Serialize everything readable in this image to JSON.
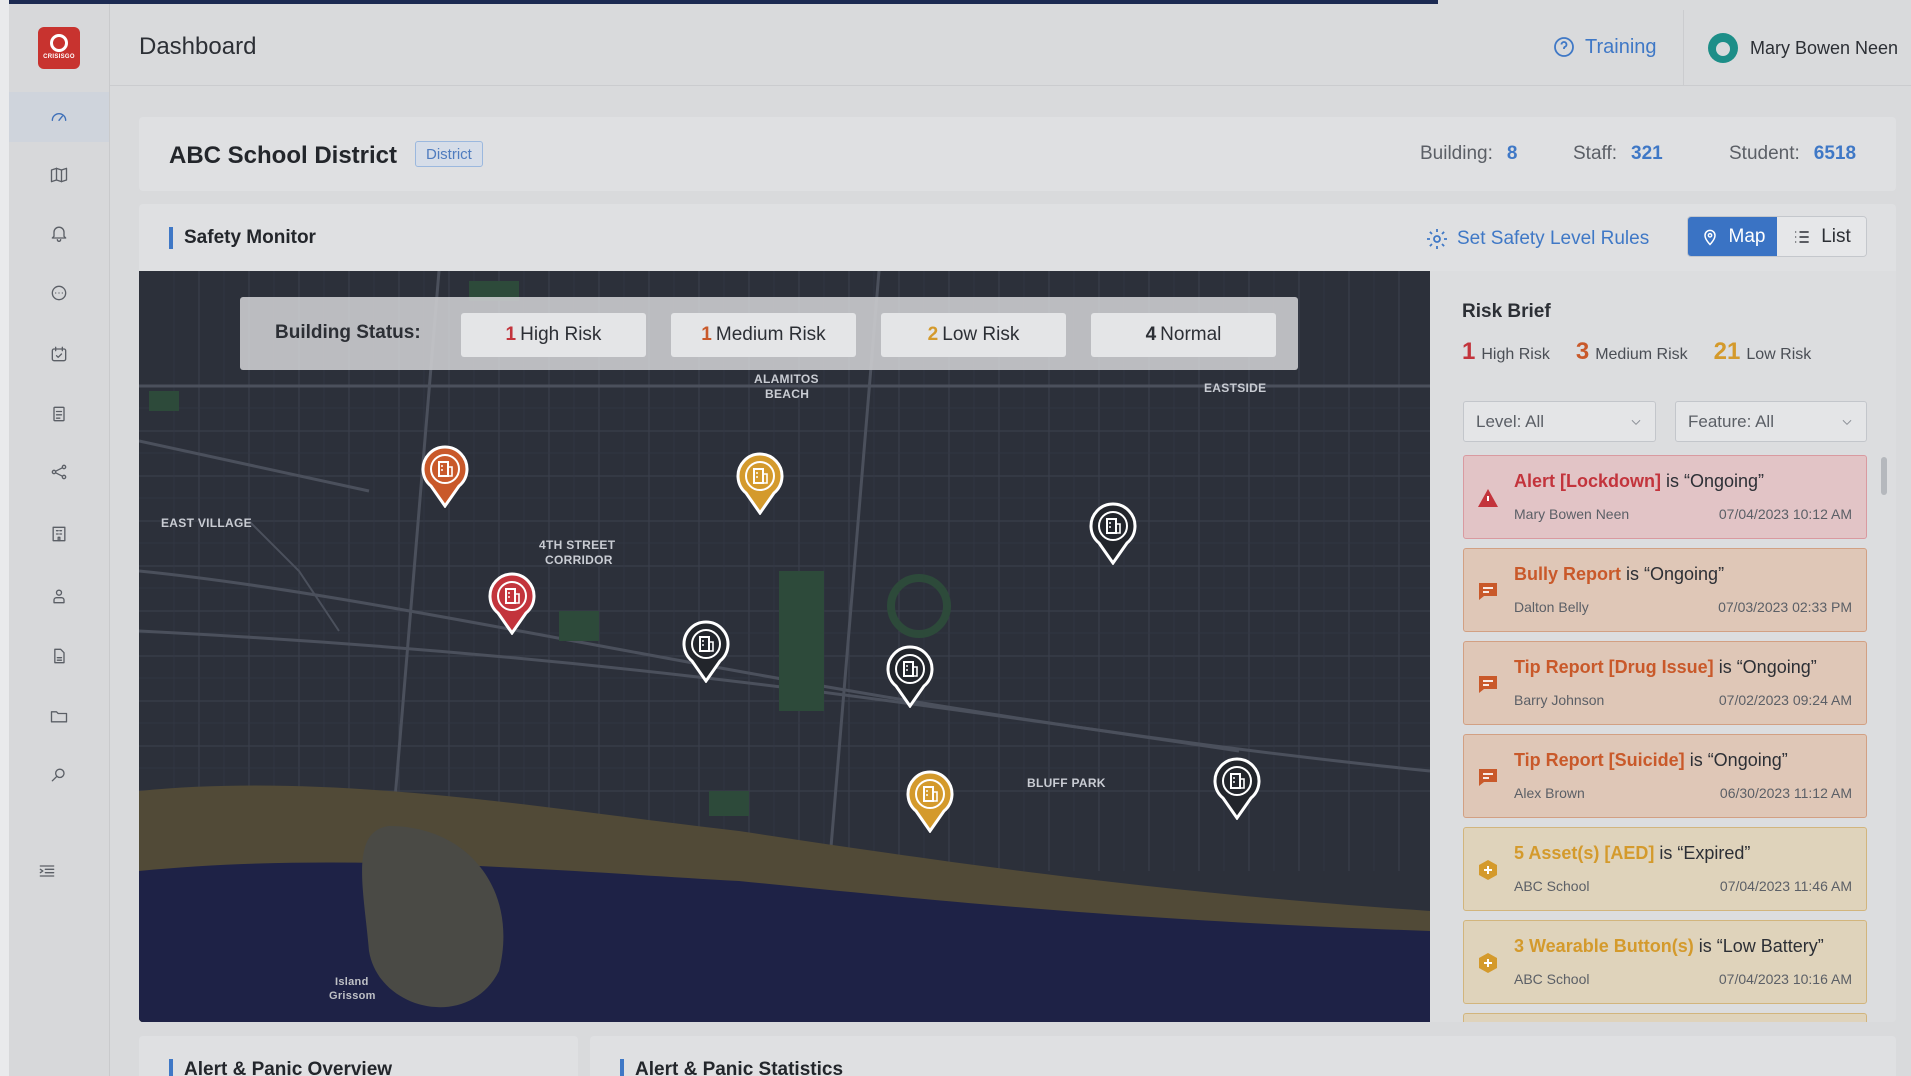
{
  "app": {
    "logo_text": "CRISISGO"
  },
  "header": {
    "title": "Dashboard",
    "training_label": "Training",
    "user_name": "Mary Bowen Neen"
  },
  "district": {
    "name": "ABC School District",
    "badge": "District",
    "stats": [
      {
        "label": "Building:",
        "value": "8"
      },
      {
        "label": "Staff:",
        "value": "321"
      },
      {
        "label": "Student:",
        "value": "6518"
      }
    ]
  },
  "safety_monitor": {
    "title": "Safety Monitor",
    "rules_link": "Set Safety Level Rules",
    "views": [
      {
        "label": "Map",
        "active": true
      },
      {
        "label": "List",
        "active": false
      }
    ],
    "building_status": {
      "label": "Building Status:",
      "items": [
        {
          "count": "1",
          "label": "High Risk",
          "color": "#c3343c"
        },
        {
          "count": "1",
          "label": "Medium Risk",
          "color": "#c9592a"
        },
        {
          "count": "2",
          "label": "Low Risk",
          "color": "#d49a2c"
        },
        {
          "count": "4",
          "label": "Normal",
          "color": "#2c2f35"
        }
      ]
    }
  },
  "map": {
    "labels": [
      "ALAMITOS",
      "BEACH",
      "EASTSIDE",
      "EAST VILLAGE",
      "4TH STREET",
      "CORRIDOR",
      "BLUFF PARK",
      "Island",
      "Grissom"
    ],
    "pins": [
      {
        "level": "medium",
        "color": "#c9592a"
      },
      {
        "level": "low",
        "color": "#d49a2c"
      },
      {
        "level": "normal",
        "color": "#22252b"
      },
      {
        "level": "high",
        "color": "#c3343c"
      },
      {
        "level": "normal",
        "color": "#22252b"
      },
      {
        "level": "normal",
        "color": "#22252b"
      },
      {
        "level": "low",
        "color": "#d49a2c"
      },
      {
        "level": "normal",
        "color": "#22252b"
      }
    ]
  },
  "risk_brief": {
    "title": "Risk Brief",
    "counts": [
      {
        "count": "1",
        "label": "High Risk",
        "color": "#c3343c"
      },
      {
        "count": "3",
        "label": "Medium Risk",
        "color": "#c9592a"
      },
      {
        "count": "21",
        "label": "Low Risk",
        "color": "#d49a2c"
      }
    ],
    "filters": {
      "level": "Level: All",
      "feature": "Feature: All"
    },
    "alerts": [
      {
        "kind": "Alert [Lockdown]",
        "status": " is “Ongoing”",
        "who": "Mary Bowen Neen",
        "when": "07/04/2023 10:12 AM",
        "tone": "red",
        "icon": "warning-icon"
      },
      {
        "kind": "Bully Report",
        "status": " is “Ongoing”",
        "who": "Dalton Belly",
        "when": "07/03/2023 02:33 PM",
        "tone": "orange",
        "icon": "report-icon"
      },
      {
        "kind": "Tip Report [Drug Issue]",
        "status": " is “Ongoing”",
        "who": "Barry Johnson",
        "when": "07/02/2023 09:24 AM",
        "tone": "orange",
        "icon": "report-icon"
      },
      {
        "kind": "Tip Report [Suicide]",
        "status": " is “Ongoing”",
        "who": "Alex Brown",
        "when": "06/30/2023 11:12 AM",
        "tone": "orange",
        "icon": "report-icon"
      },
      {
        "kind": "5 Asset(s) [AED]",
        "status": " is “Expired”",
        "who": "ABC School",
        "when": "07/04/2023 11:46 AM",
        "tone": "yellow",
        "icon": "asset-icon"
      },
      {
        "kind": "3 Wearable Button(s)",
        "status": " is “Low Battery”",
        "who": "ABC School",
        "when": "07/04/2023 10:16 AM",
        "tone": "yellow",
        "icon": "asset-icon"
      }
    ]
  },
  "bottom": {
    "overview_title": "Alert & Panic Overview",
    "statistics_title": "Alert & Panic Statistics"
  }
}
